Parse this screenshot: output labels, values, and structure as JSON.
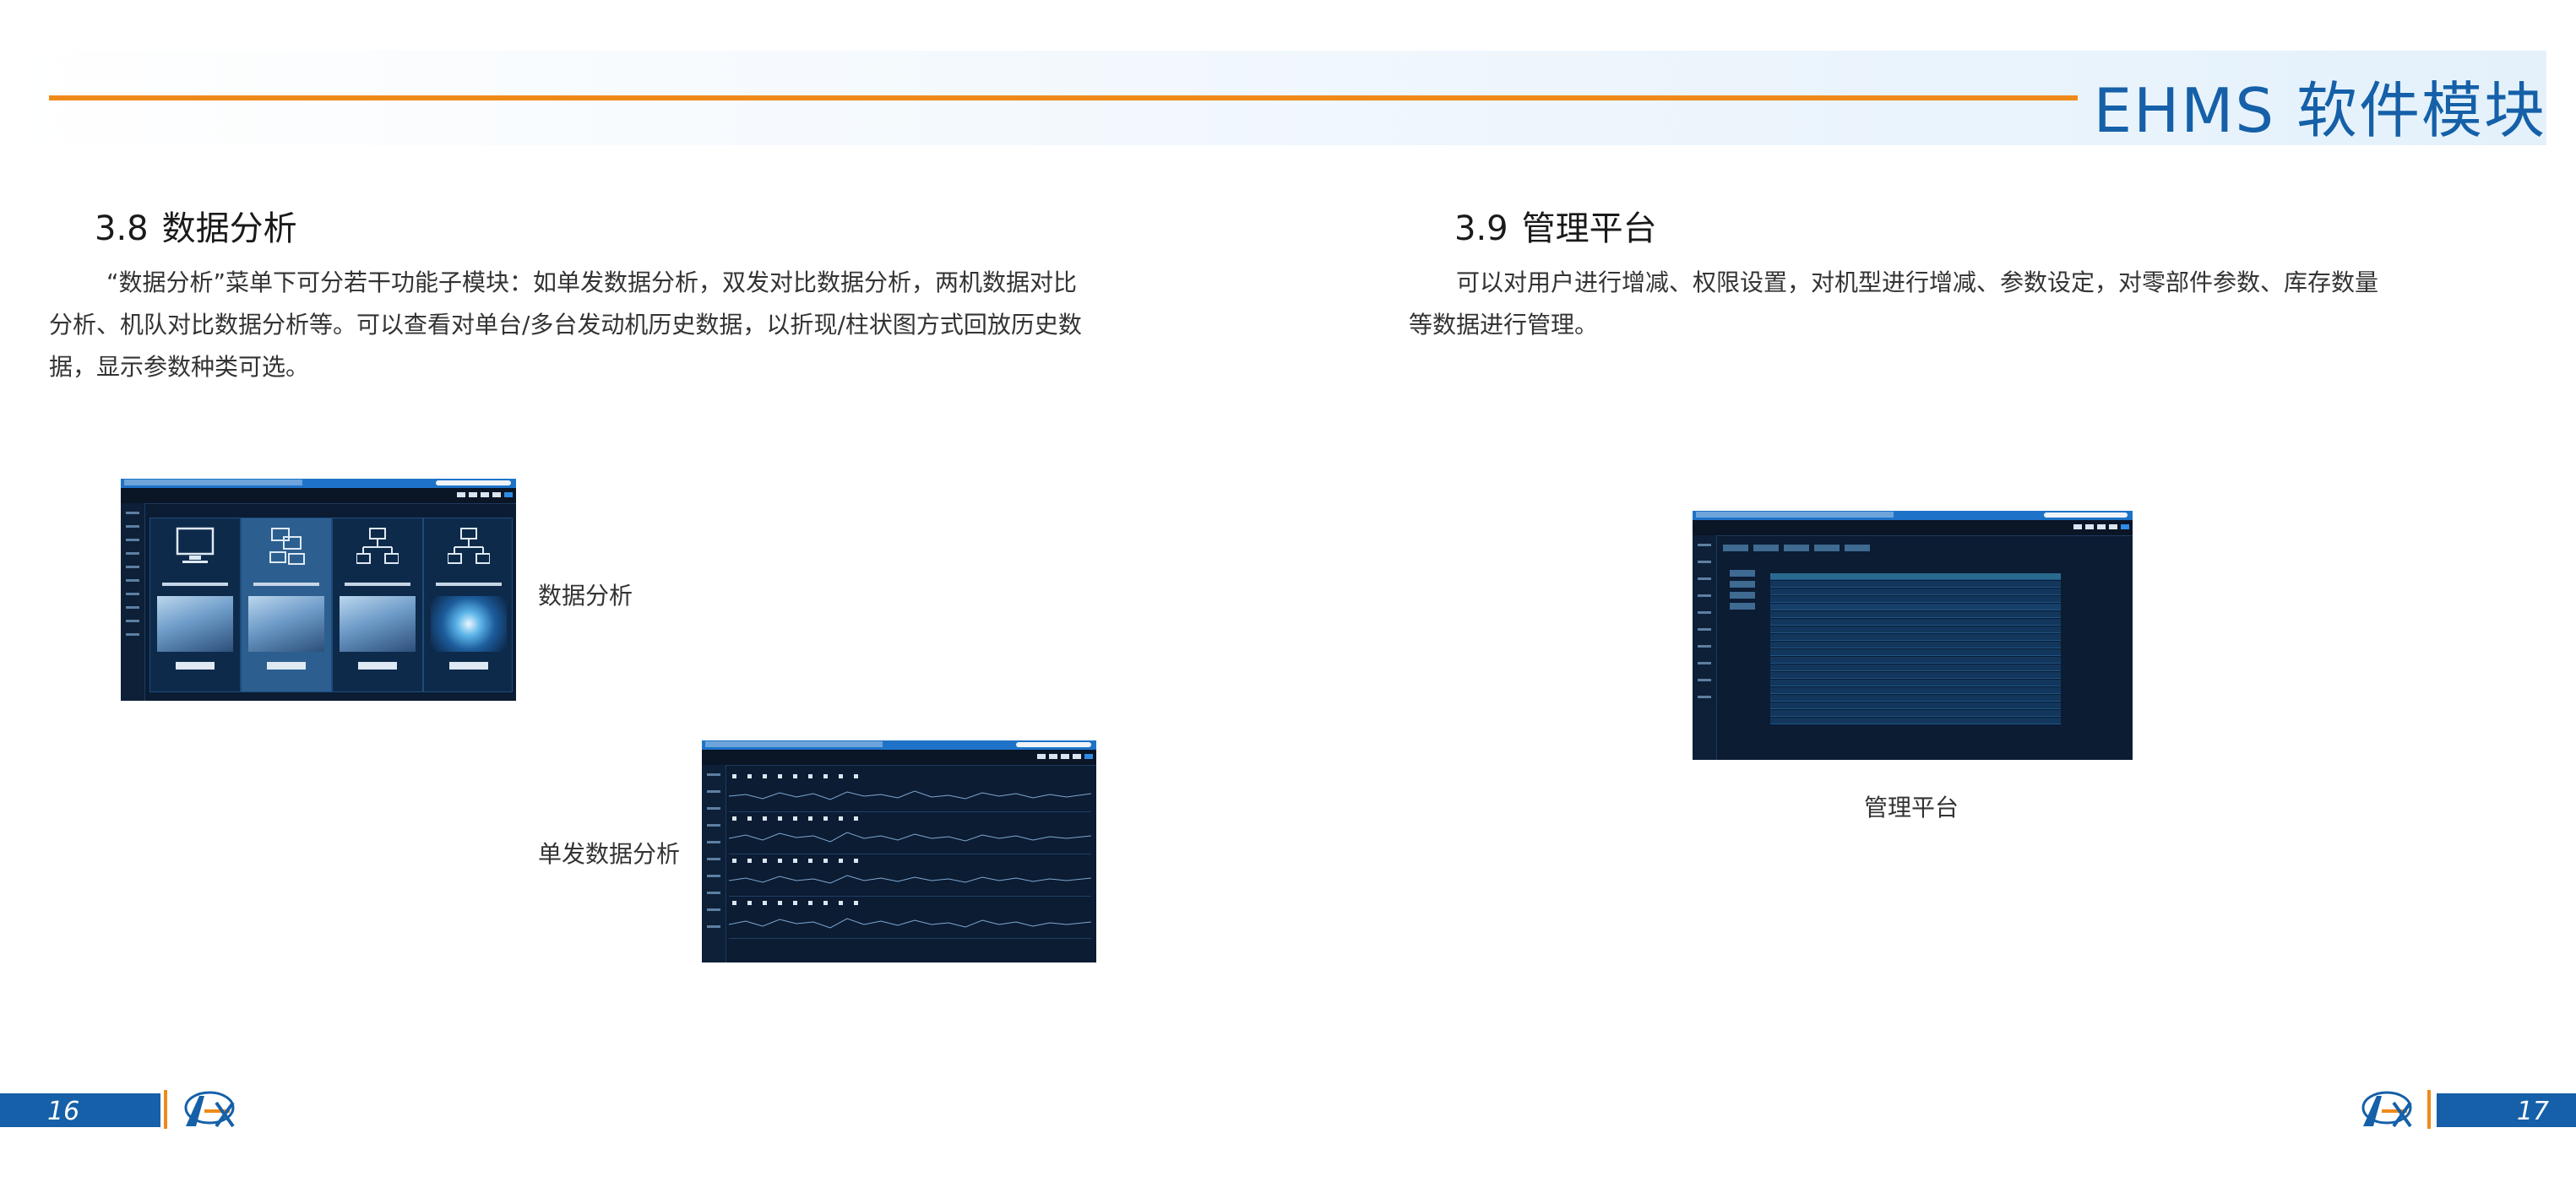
{
  "header": {
    "title": "EHMS 软件模块"
  },
  "left_section": {
    "number": "3.8",
    "title": "数据分析",
    "paragraph": "“数据分析”菜单下可分若干功能子模块：如单发数据分析，双发对比数据分析，两机数据对比分析、机队对比数据分析等。可以查看对单台/多台发动机历史数据，以折现/柱状图方式回放历史数据，显示参数种类可选。",
    "captions": [
      "数据分析",
      "单发数据分析"
    ]
  },
  "right_section": {
    "number": "3.9",
    "title": "管理平台",
    "paragraph": "可以对用户进行增减、权限设置，对机型进行增减、参数设定，对零部件参数、库存数量等数据进行管理。",
    "caption": "管理平台"
  },
  "footer": {
    "page_left": "16",
    "page_right": "17"
  },
  "colors": {
    "brand_blue": "#1560a8",
    "accent_orange": "#ef8a1a"
  },
  "icons": [
    "monitor-icon",
    "network-icon",
    "logo-icon"
  ]
}
